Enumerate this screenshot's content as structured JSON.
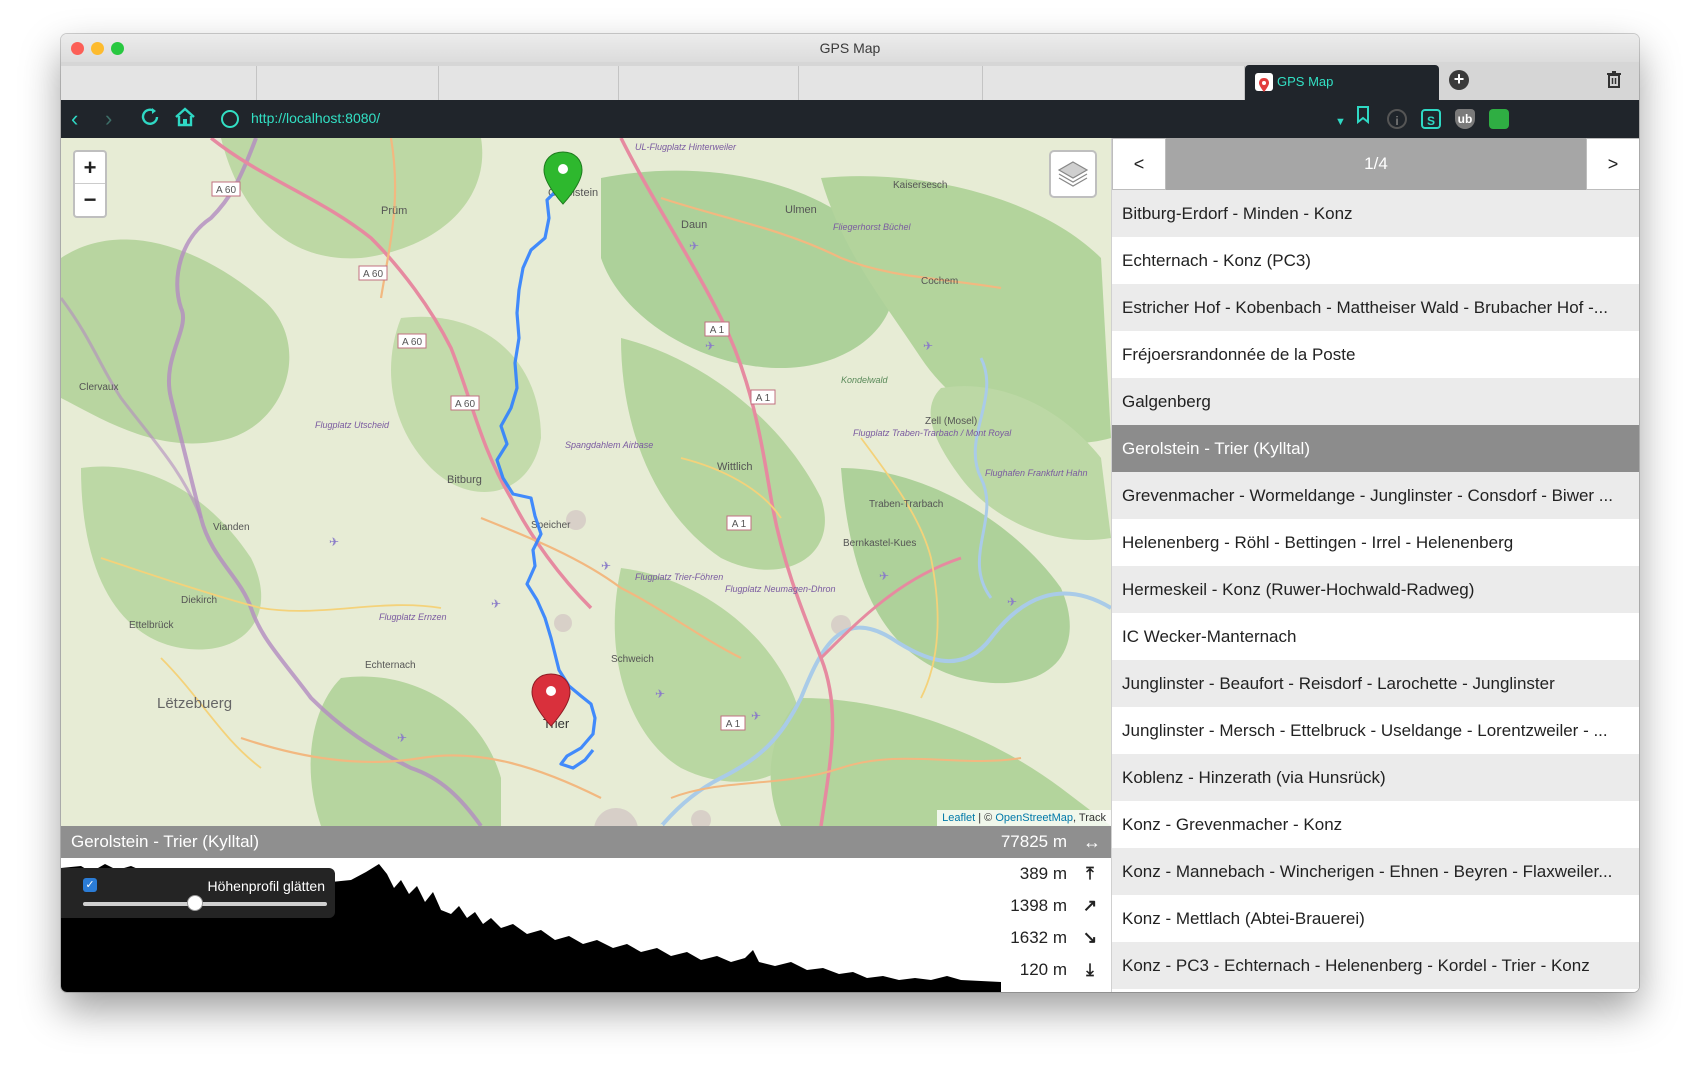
{
  "window": {
    "title": "GPS Map"
  },
  "browser": {
    "active_tab": "GPS Map",
    "url": "http://localhost:8080/"
  },
  "map": {
    "zoom_in": "+",
    "zoom_out": "−",
    "places": [
      "Gerolstein",
      "Prüm",
      "Daun",
      "Ulmen",
      "Kaisersesch",
      "Cochem",
      "Clervaux",
      "Bitburg",
      "Wittlich",
      "Zell (Mosel)",
      "Vianden",
      "Speicher",
      "Traben-Trarbach",
      "Bernkastel-Kues",
      "Diekirch",
      "Ettelbrück",
      "Echternach",
      "Schweich",
      "Trier",
      "Lëtzebuerg",
      "Kondelwald",
      "Spangdahlem Airbase",
      "UL-Flugplatz Hinterweiler",
      "Fliegerhorst Büchel",
      "Flugplatz Utscheid",
      "Flugplatz Traben-Trarbach / Mont Royal",
      "Flugplatz Trier-Föhren",
      "Flugplatz Neumagen-Dhron",
      "Flugplatz Ernzen",
      "Flughafen Frankfurt Hahn"
    ],
    "roads": [
      "A 60",
      "A 60",
      "A 60",
      "A 60",
      "A 1",
      "A 1",
      "A 1",
      "A 1"
    ],
    "attribution": {
      "leaflet": "Leaflet",
      "sep": " | © ",
      "osm": "OpenStreetMap",
      "suffix": ", Track"
    }
  },
  "track": {
    "name": "Gerolstein - Trier (Kylltal)",
    "distance": "77825 m",
    "max_elevation": "389 m",
    "ascent": "1398 m",
    "descent": "1632 m",
    "min_elevation": "120 m",
    "smooth_label": "Höhenprofil glätten",
    "smooth_checked": true,
    "smooth_level": 0.46
  },
  "sidebar": {
    "prev": "<",
    "next": ">",
    "page": "1/4",
    "items": [
      "Bitburg-Erdorf - Minden - Konz",
      "Echternach - Konz (PC3)",
      "Estricher Hof - Kobenbach - Mattheiser Wald - Brubacher Hof -...",
      "Fréjoersrandonnée de la Poste",
      "Galgenberg",
      "Gerolstein - Trier (Kylltal)",
      "Grevenmacher - Wormeldange - Junglinster - Consdorf - Biwer ...",
      "Helenenberg - Röhl - Bettingen - Irrel - Helenenberg",
      "Hermeskeil - Konz (Ruwer-Hochwald-Radweg)",
      "IC Wecker-Manternach",
      "Junglinster - Beaufort - Reisdorf - Larochette - Junglinster",
      "Junglinster - Mersch - Ettelbruck - Useldange - Lorentzweiler - ...",
      "Koblenz - Hinzerath (via Hunsrück)",
      "Konz - Grevenmacher - Konz",
      "Konz - Mannebach - Wincherigen - Ehnen - Beyren - Flaxweiler...",
      "Konz - Mettlach (Abtei-Brauerei)",
      "Konz - PC3 - Echternach - Helenenberg - Kordel - Trier - Konz"
    ],
    "selected_index": 5
  },
  "colors": {
    "track": "#2f80ff",
    "start_marker": "#2eb82e",
    "end_marker": "#d9303c",
    "accent": "#32e0c4"
  },
  "icons": [
    "back-icon",
    "forward-icon",
    "reload-icon",
    "home-icon",
    "globe-icon",
    "bookmark-icon",
    "trash-icon",
    "add-tab-icon",
    "layers-icon",
    "width-arrow-icon",
    "max-arrow-icon",
    "ascent-arrow-icon",
    "descent-arrow-icon",
    "min-arrow-icon"
  ]
}
